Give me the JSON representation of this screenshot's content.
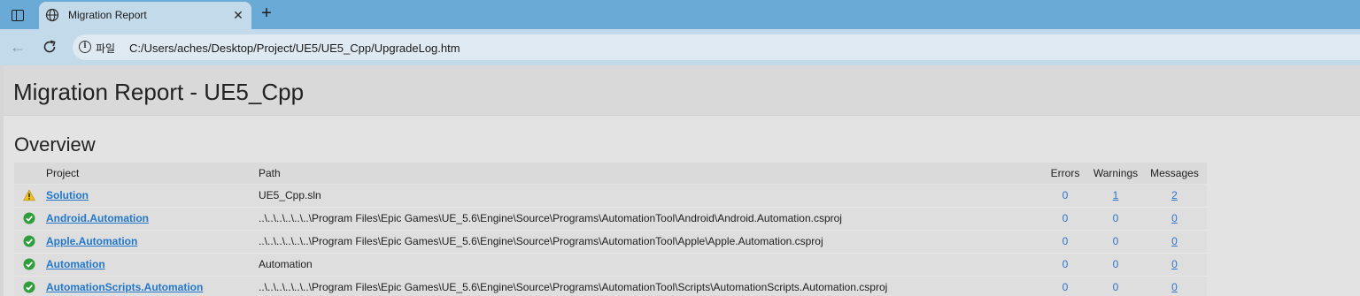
{
  "browser": {
    "tab_title": "Migration Report",
    "address_scheme": "파일",
    "address_url": "C:/Users/aches/Desktop/Project/UE5/UE5_Cpp/UpgradeLog.htm"
  },
  "report": {
    "title": "Migration Report - UE5_Cpp",
    "overview_heading": "Overview",
    "columns": {
      "project": "Project",
      "path": "Path",
      "errors": "Errors",
      "warnings": "Warnings",
      "messages": "Messages"
    },
    "rows": [
      {
        "status": "warning",
        "status_icon": "warning-icon",
        "project": "Solution",
        "path": "UE5_Cpp.sln",
        "errors": "0",
        "warnings": "1",
        "messages": "2"
      },
      {
        "status": "ok",
        "status_icon": "check-circle-icon",
        "project": "Android.Automation",
        "path": "..\\..\\..\\..\\..\\..\\Program Files\\Epic Games\\UE_5.6\\Engine\\Source\\Programs\\AutomationTool\\Android\\Android.Automation.csproj",
        "errors": "0",
        "warnings": "0",
        "messages": "0"
      },
      {
        "status": "ok",
        "status_icon": "check-circle-icon",
        "project": "Apple.Automation",
        "path": "..\\..\\..\\..\\..\\..\\Program Files\\Epic Games\\UE_5.6\\Engine\\Source\\Programs\\AutomationTool\\Apple\\Apple.Automation.csproj",
        "errors": "0",
        "warnings": "0",
        "messages": "0"
      },
      {
        "status": "ok",
        "status_icon": "check-circle-icon",
        "project": "Automation",
        "path": "Automation",
        "errors": "0",
        "warnings": "0",
        "messages": "0"
      },
      {
        "status": "ok",
        "status_icon": "check-circle-icon",
        "project": "AutomationScripts.Automation",
        "path": "..\\..\\..\\..\\..\\..\\Program Files\\Epic Games\\UE_5.6\\Engine\\Source\\Programs\\AutomationTool\\Scripts\\AutomationScripts.Automation.csproj",
        "errors": "0",
        "warnings": "0",
        "messages": "0"
      }
    ]
  },
  "colors": {
    "tabstrip": "#6aaad6",
    "toolbar": "#c3daea",
    "link": "#2277cc",
    "ok_green": "#2e9e3a",
    "warning_yellow": "#f2c21b"
  }
}
